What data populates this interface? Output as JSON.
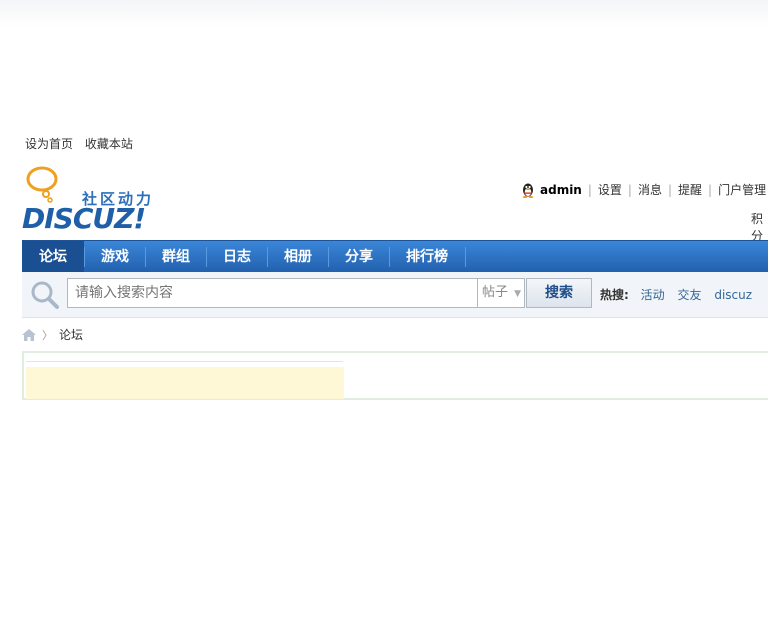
{
  "toplinks": {
    "set_home": "设为首页",
    "bookmark": "收藏本站"
  },
  "logo": {
    "tagline": "社区动力",
    "brand": "DISCUZ!"
  },
  "userbar": {
    "username": "admin",
    "settings": "设置",
    "messages": "消息",
    "reminders": "提醒",
    "portal_admin": "门户管理",
    "credits_prefix": "积分"
  },
  "nav": {
    "items": [
      {
        "label": "论坛",
        "active": true
      },
      {
        "label": "游戏"
      },
      {
        "label": "群组"
      },
      {
        "label": "日志"
      },
      {
        "label": "相册"
      },
      {
        "label": "分享"
      },
      {
        "label": "排行榜"
      }
    ]
  },
  "search": {
    "placeholder": "请输入搜索内容",
    "type": "帖子",
    "button": "搜索",
    "hot_label": "热搜:",
    "hot_keywords": [
      "活动",
      "交友",
      "discuz"
    ]
  },
  "breadcrumb": {
    "current": "论坛"
  },
  "colors": {
    "nav_bg": "#2c72c7",
    "accent": "#1f5fa7",
    "notice_bg": "#fff8d6"
  }
}
